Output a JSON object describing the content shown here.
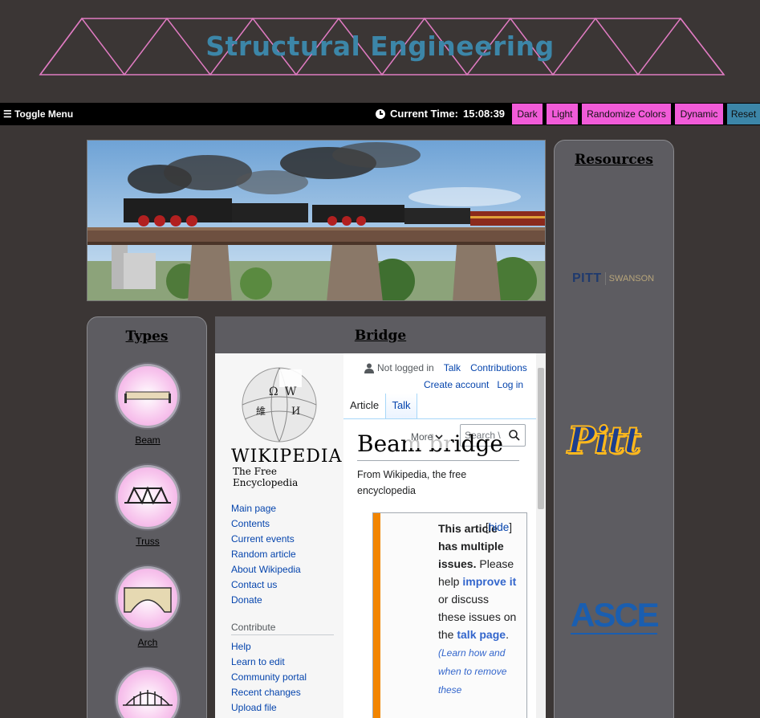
{
  "site": {
    "title": "Structural Engineering"
  },
  "topbar": {
    "toggle_label": "☰ Toggle Menu",
    "time_label": "Current Time:",
    "time_value": "15:08:39",
    "buttons": [
      {
        "label": "Dark",
        "color": "#f15bd8"
      },
      {
        "label": "Light",
        "color": "#f15bd8"
      },
      {
        "label": "Randomize Colors",
        "color": "#f15bd8"
      },
      {
        "label": "Dynamic",
        "color": "#f15bd8"
      },
      {
        "label": "Reset",
        "color": "#3c86a8"
      }
    ]
  },
  "types": {
    "title": "Types",
    "items": [
      {
        "label": "Beam",
        "icon": "beam-bridge-icon"
      },
      {
        "label": "Truss",
        "icon": "truss-bridge-icon"
      },
      {
        "label": "Arch",
        "icon": "arch-bridge-icon"
      },
      {
        "label": "",
        "icon": "tied-arch-bridge-icon"
      }
    ]
  },
  "bridge": {
    "title": "Bridge"
  },
  "resources": {
    "title": "Resources",
    "logos": [
      "pitt-swanson-logo",
      "pitt-script-logo",
      "asce-logo"
    ],
    "pitt_swanson": {
      "pitt": "PITT",
      "swanson": "SWANSON"
    },
    "pitt_script": "Pitt",
    "asce": "ASCE"
  },
  "wiki": {
    "wordmark": "WIKIPEDIA",
    "tagline": "The Free Encyclopedia",
    "user": {
      "not_logged": "Not logged in",
      "talk": "Talk",
      "contributions": "Contributions",
      "create_account": "Create account",
      "login": "Log in"
    },
    "tabs": {
      "article": "Article",
      "talk": "Talk",
      "more": "More"
    },
    "search_placeholder": "Search \\",
    "article_title": "Beam bridge",
    "from": "From Wikipedia, the free encyclopedia",
    "nav": [
      "Main page",
      "Contents",
      "Current events",
      "Random article",
      "About Wikipedia",
      "Contact us",
      "Donate"
    ],
    "contribute_heading": "Contribute",
    "contribute": [
      "Help",
      "Learn to edit",
      "Community portal",
      "Recent changes",
      "Upload file"
    ],
    "notice": {
      "bold": "This article has multiple issues.",
      "text1": "Please help",
      "improve": "improve it",
      "text2": "or discuss these issues on the",
      "talk": "talk page",
      "italic": "(Learn how and when to remove these",
      "hide": "hide"
    }
  }
}
